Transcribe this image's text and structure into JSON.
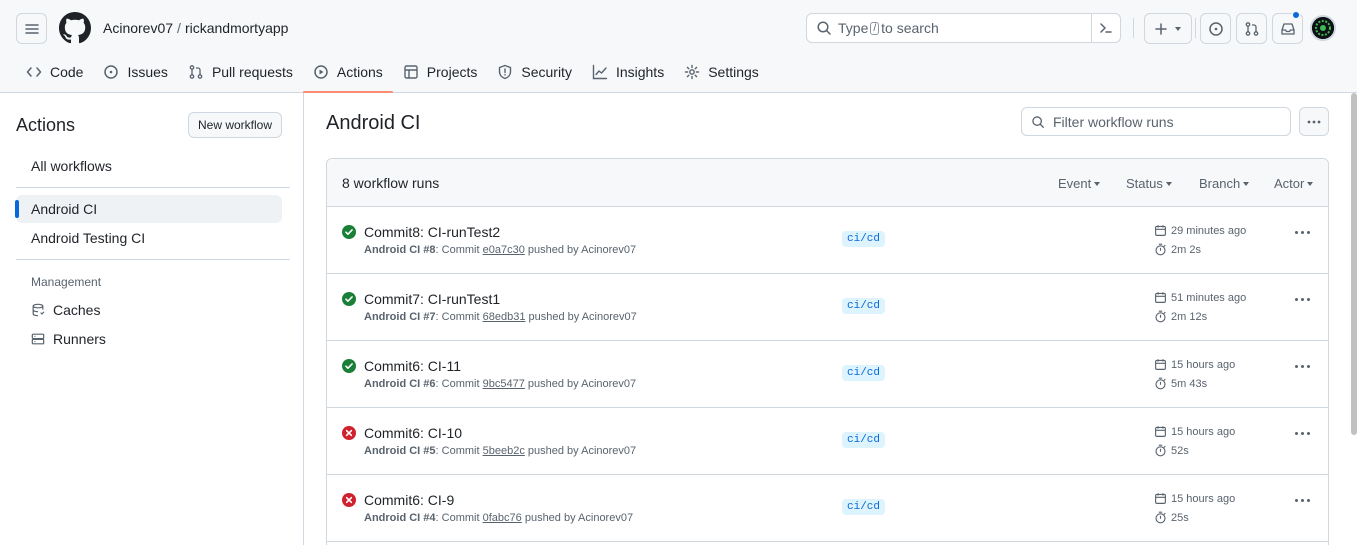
{
  "header": {
    "owner": "Acinorev07",
    "separator": "/",
    "repo": "rickandmortyapp",
    "search_prefix": "Type",
    "search_key": "/",
    "search_suffix": "to search"
  },
  "tabs": [
    {
      "label": "Code",
      "icon": "code-icon"
    },
    {
      "label": "Issues",
      "icon": "issue-icon"
    },
    {
      "label": "Pull requests",
      "icon": "pull-request-icon"
    },
    {
      "label": "Actions",
      "icon": "play-icon",
      "active": true
    },
    {
      "label": "Projects",
      "icon": "table-icon"
    },
    {
      "label": "Security",
      "icon": "shield-icon"
    },
    {
      "label": "Insights",
      "icon": "graph-icon"
    },
    {
      "label": "Settings",
      "icon": "gear-icon"
    }
  ],
  "sidebar": {
    "title": "Actions",
    "new_workflow": "New workflow",
    "all_workflows": "All workflows",
    "workflows": [
      {
        "label": "Android CI",
        "active": true
      },
      {
        "label": "Android Testing CI"
      }
    ],
    "management_heading": "Management",
    "management": [
      {
        "label": "Caches",
        "icon": "cache-icon"
      },
      {
        "label": "Runners",
        "icon": "server-icon"
      }
    ]
  },
  "main": {
    "title": "Android CI",
    "filter_placeholder": "Filter workflow runs",
    "runs_count": "8 workflow runs",
    "filters": [
      "Event",
      "Status",
      "Branch",
      "Actor"
    ],
    "runs": [
      {
        "status": "success",
        "title": "Commit8: CI-runTest2",
        "workflow": "Android CI",
        "number": "#8",
        "commit_label": "Commit",
        "sha": "e0a7c30",
        "pushed_by": "pushed by Acinorev07",
        "branch": "ci/cd",
        "when": "29 minutes ago",
        "duration": "2m 2s"
      },
      {
        "status": "success",
        "title": "Commit7: CI-runTest1",
        "workflow": "Android CI",
        "number": "#7",
        "commit_label": "Commit",
        "sha": "68edb31",
        "pushed_by": "pushed by Acinorev07",
        "branch": "ci/cd",
        "when": "51 minutes ago",
        "duration": "2m 12s"
      },
      {
        "status": "success",
        "title": "Commit6: CI-11",
        "workflow": "Android CI",
        "number": "#6",
        "commit_label": "Commit",
        "sha": "9bc5477",
        "pushed_by": "pushed by Acinorev07",
        "branch": "ci/cd",
        "when": "15 hours ago",
        "duration": "5m 43s"
      },
      {
        "status": "failure",
        "title": "Commit6: CI-10",
        "workflow": "Android CI",
        "number": "#5",
        "commit_label": "Commit",
        "sha": "5beeb2c",
        "pushed_by": "pushed by Acinorev07",
        "branch": "ci/cd",
        "when": "15 hours ago",
        "duration": "52s"
      },
      {
        "status": "failure",
        "title": "Commit6: CI-9",
        "workflow": "Android CI",
        "number": "#4",
        "commit_label": "Commit",
        "sha": "0fabc76",
        "pushed_by": "pushed by Acinorev07",
        "branch": "ci/cd",
        "when": "15 hours ago",
        "duration": "25s"
      }
    ]
  },
  "colors": {
    "success": "#1a7f37",
    "failure": "#cf222e",
    "accent": "#0969da",
    "tab_underline": "#fd8c73"
  }
}
